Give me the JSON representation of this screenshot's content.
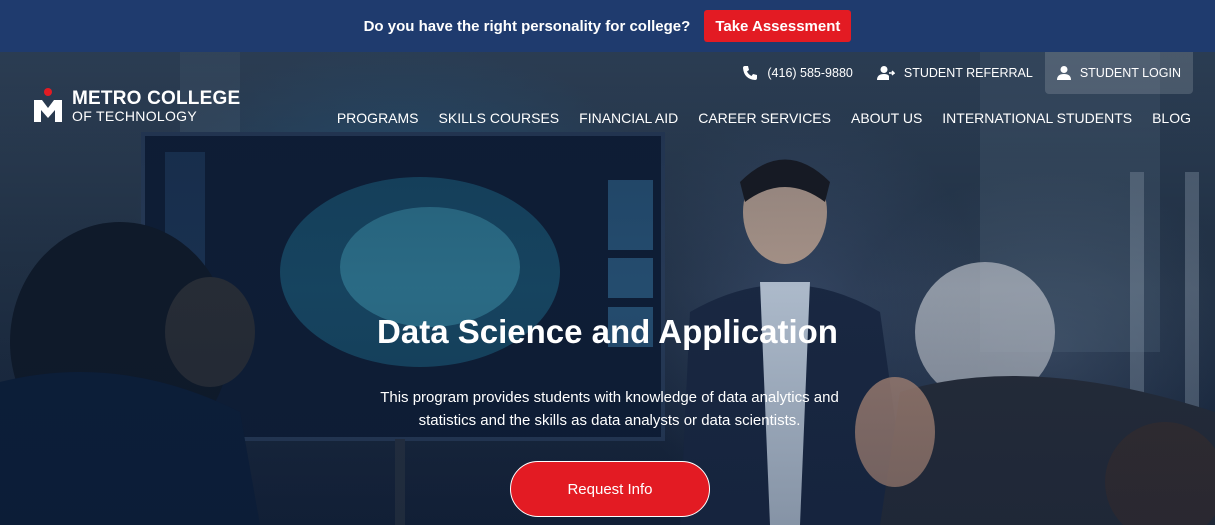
{
  "topbar": {
    "question": "Do you have the right personality for college?",
    "cta_label": "Take Assessment"
  },
  "logo": {
    "line1": "METRO COLLEGE",
    "line2": "OF TECHNOLOGY"
  },
  "utility": {
    "phone": "(416) 585-9880",
    "referral": "STUDENT REFERRAL",
    "login": "STUDENT LOGIN"
  },
  "nav": {
    "items": [
      "PROGRAMS",
      "SKILLS COURSES",
      "FINANCIAL AID",
      "CAREER SERVICES",
      "ABOUT US",
      "INTERNATIONAL STUDENTS",
      "BLOG"
    ]
  },
  "hero": {
    "title": "Data Science and Application",
    "description_line1": "This program provides students with knowledge of data analytics and",
    "description_line2": "statistics and the skills as data analysts or data scientists.",
    "cta_label": "Request Info"
  },
  "colors": {
    "topbar_bg": "#1f3b6e",
    "accent_red": "#e31b23"
  },
  "icons": {
    "phone": "phone-icon",
    "referral": "user-share-icon",
    "login": "user-icon",
    "logo": "metro-logo-mark"
  }
}
